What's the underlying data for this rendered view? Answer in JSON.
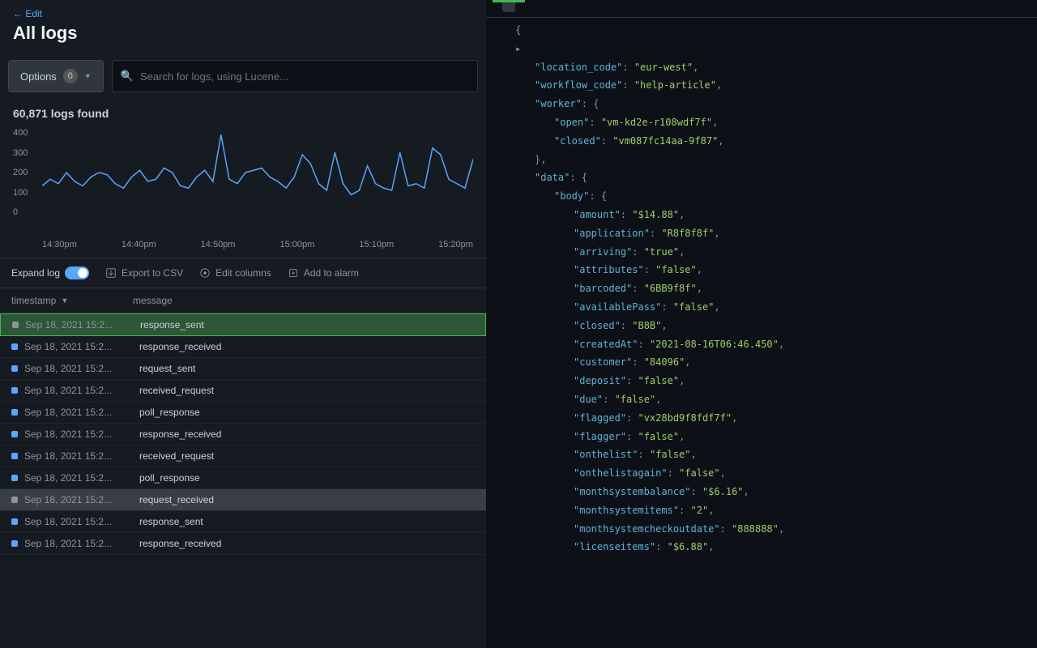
{
  "header": {
    "back": "← Edit",
    "title": "All logs"
  },
  "search": {
    "options_label": "Options",
    "options_count": "0",
    "placeholder": "Search for logs, using Lucene..."
  },
  "chart": {
    "title": "60,871 logs found",
    "y_ticks": [
      "400",
      "300",
      "200",
      "100",
      "0"
    ],
    "x_ticks": [
      "14:30pm",
      "14:40pm",
      "14:50pm",
      "15:00pm",
      "15:10pm",
      "15:20pm"
    ]
  },
  "chart_data": {
    "type": "line",
    "title": "60,871 logs found",
    "xlabel": "",
    "ylabel": "",
    "ylim": [
      0,
      400
    ],
    "categories": [
      "14:30pm",
      "14:40pm",
      "14:50pm",
      "15:00pm",
      "15:10pm",
      "15:20pm"
    ],
    "values": [
      140,
      170,
      150,
      200,
      160,
      140,
      180,
      200,
      190,
      150,
      130,
      180,
      210,
      160,
      170,
      220,
      200,
      140,
      130,
      180,
      210,
      160,
      370,
      170,
      150,
      200,
      210,
      220,
      180,
      160,
      130,
      180,
      280,
      240,
      150,
      120,
      290,
      150,
      100,
      120,
      230,
      150,
      130,
      120,
      290,
      140,
      150,
      130,
      310,
      280,
      170,
      150,
      130,
      260
    ]
  },
  "toolbar": {
    "expand_log": "Expand log",
    "export_label": "Export to CSV",
    "edit_columns": "Edit columns",
    "add_alarm": "Add to alarm"
  },
  "table": {
    "headers": {
      "timestamp": "timestamp",
      "message": "message"
    },
    "rows": [
      {
        "ts": "Sep 18, 2021 15:2...",
        "msg": "response_sent",
        "state": "selected"
      },
      {
        "ts": "Sep 18, 2021 15:2...",
        "msg": "response_received",
        "state": ""
      },
      {
        "ts": "Sep 18, 2021 15:2...",
        "msg": "request_sent",
        "state": ""
      },
      {
        "ts": "Sep 18, 2021 15:2...",
        "msg": "received_request",
        "state": ""
      },
      {
        "ts": "Sep 18, 2021 15:2...",
        "msg": "poll_response",
        "state": ""
      },
      {
        "ts": "Sep 18, 2021 15:2...",
        "msg": "response_received",
        "state": ""
      },
      {
        "ts": "Sep 18, 2021 15:2...",
        "msg": "received_request",
        "state": ""
      },
      {
        "ts": "Sep 18, 2021 15:2...",
        "msg": "poll_response",
        "state": ""
      },
      {
        "ts": "Sep 18, 2021 15:2...",
        "msg": "request_received",
        "state": "hovered"
      },
      {
        "ts": "Sep 18, 2021 15:2...",
        "msg": "response_sent",
        "state": ""
      },
      {
        "ts": "Sep 18, 2021 15:2...",
        "msg": "response_received",
        "state": ""
      }
    ]
  },
  "json": {
    "lines": [
      {
        "indent": 0,
        "text": "{"
      },
      {
        "indent": 0,
        "text": "▸",
        "collapse": true
      },
      {
        "indent": 1,
        "key": "\"location_code\"",
        "val": "\"eur-west\""
      },
      {
        "indent": 1,
        "key": "\"workflow_code\"",
        "val": "\"help-article\""
      },
      {
        "indent": 1,
        "key": "\"worker\"",
        "open": "{"
      },
      {
        "indent": 2,
        "key": "\"open\"",
        "val": "\"vm-kd2e-r108wdf7f\""
      },
      {
        "indent": 2,
        "key": "\"closed\"",
        "val": "\"vm087fc14aa-9f87\""
      },
      {
        "indent": 1,
        "close": "},"
      },
      {
        "indent": 1,
        "key": "\"data\"",
        "open": "{"
      },
      {
        "indent": 2,
        "key": "\"body\"",
        "open": "{"
      },
      {
        "indent": 3,
        "key": "\"amount\"",
        "val": "\"$14.88\""
      },
      {
        "indent": 3,
        "key": "\"application\"",
        "val": "\"R8f8f8f\""
      },
      {
        "indent": 3,
        "key": "\"arriving\"",
        "val": "\"true\""
      },
      {
        "indent": 3,
        "key": "\"attributes\"",
        "val": "\"false\""
      },
      {
        "indent": 3,
        "key": "\"barcoded\"",
        "val": "\"6BB9f8f\""
      },
      {
        "indent": 3,
        "key": "\"availablePass\"",
        "val": "\"false\""
      },
      {
        "indent": 3,
        "key": "\"closed\"",
        "val": "\"B8B\""
      },
      {
        "indent": 3,
        "key": "\"createdAt\"",
        "val": "\"2021-08-16T06:46.450\""
      },
      {
        "indent": 3,
        "key": "\"customer\"",
        "val": "\"84096\""
      },
      {
        "indent": 3,
        "key": "\"deposit\"",
        "val": "\"false\""
      },
      {
        "indent": 3,
        "key": "\"due\"",
        "val": "\"false\""
      },
      {
        "indent": 3,
        "key": "\"flagged\"",
        "val": "\"vx28bd9f8fdf7f\""
      },
      {
        "indent": 3,
        "key": "\"flagger\"",
        "val": "\"false\""
      },
      {
        "indent": 3,
        "key": "\"onthelist\"",
        "val": "\"false\""
      },
      {
        "indent": 3,
        "key": "\"onthelistagain\"",
        "val": "\"false\""
      },
      {
        "indent": 3,
        "key": "\"monthsystembalance\"",
        "val": "\"$6.16\""
      },
      {
        "indent": 3,
        "key": "\"monthsystemitems\"",
        "val": "\"2\""
      },
      {
        "indent": 3,
        "key": "\"monthsystemcheckoutdate\"",
        "val": "\"888888\""
      },
      {
        "indent": 3,
        "key": "\"licenseitems\"",
        "val": "\"$6.88\""
      }
    ]
  }
}
